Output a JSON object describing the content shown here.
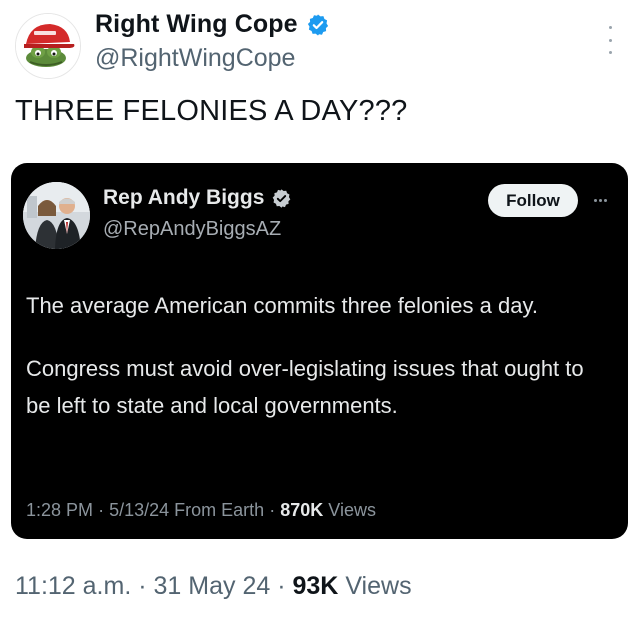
{
  "author": {
    "display_name": "Right Wing Cope",
    "handle": "@RightWingCope",
    "verified": true
  },
  "tweet": {
    "text": "THREE FELONIES A DAY???"
  },
  "quoted_tweet": {
    "author": {
      "display_name": "Rep Andy Biggs",
      "handle": "@RepAndyBiggsAZ",
      "verified": true
    },
    "follow_label": "Follow",
    "paragraphs": [
      "The average American commits three felonies a day.",
      "Congress must avoid over-legislating issues that ought to be left to state and local governments."
    ],
    "meta": {
      "time": "1:28 PM",
      "date": "5/13/24",
      "source": "From Earth",
      "views_count": "870K",
      "views_label": "Views",
      "separator": "·"
    }
  },
  "meta": {
    "time": "11:12 a.m.",
    "date": "31 May 24",
    "views_count": "93K",
    "views_label": "Views",
    "separator": "·"
  },
  "colors": {
    "verified_blue": "#1d9bf0",
    "card_background": "#000000",
    "secondary_text": "#536471",
    "maga_hat_red": "#d42a2a",
    "frog_green": "#5c8b3a"
  },
  "icons": {
    "outer_more": "more-vertical-icon",
    "inner_more": "more-horizontal-icon",
    "verified": "verified-badge-icon"
  }
}
